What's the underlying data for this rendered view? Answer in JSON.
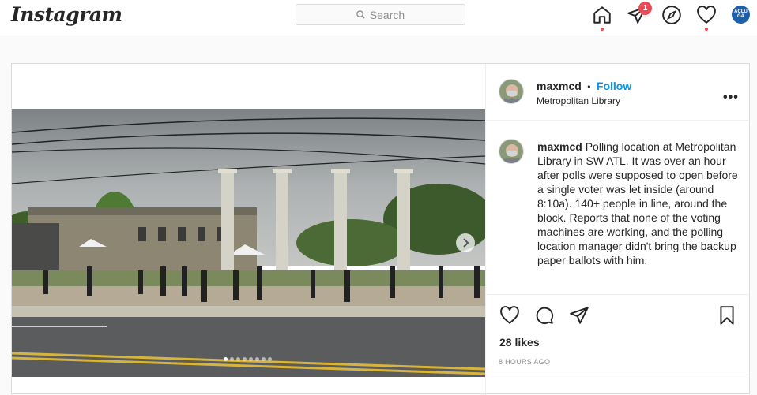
{
  "nav": {
    "logo": "Instagram",
    "search_placeholder": "Search",
    "notification_count": "1",
    "profile_initials": "ACLU GA",
    "icons": [
      "home-icon",
      "direct-icon",
      "explore-icon",
      "activity-icon"
    ]
  },
  "post": {
    "username": "maxmcd",
    "separator": "•",
    "follow_label": "Follow",
    "location": "Metropolitan Library",
    "more_label": "•••",
    "caption_username": "maxmcd",
    "caption_text": "Polling location at Metropolitan Library in SW ATL. It was over an hour after polls were supposed to open before a single voter was let inside (around 8:10a). 140+ people in line, around the block. Reports that none of the voting machines are working, and the polling location manager didn't bring the backup paper ballots with him.",
    "likes": "28 likes",
    "timestamp": "8 HOURS AGO",
    "carousel_count": 8,
    "carousel_index": 0
  },
  "colors": {
    "accent": "#0095f6",
    "badge": "#ed4956",
    "border": "#dbdbdb"
  }
}
